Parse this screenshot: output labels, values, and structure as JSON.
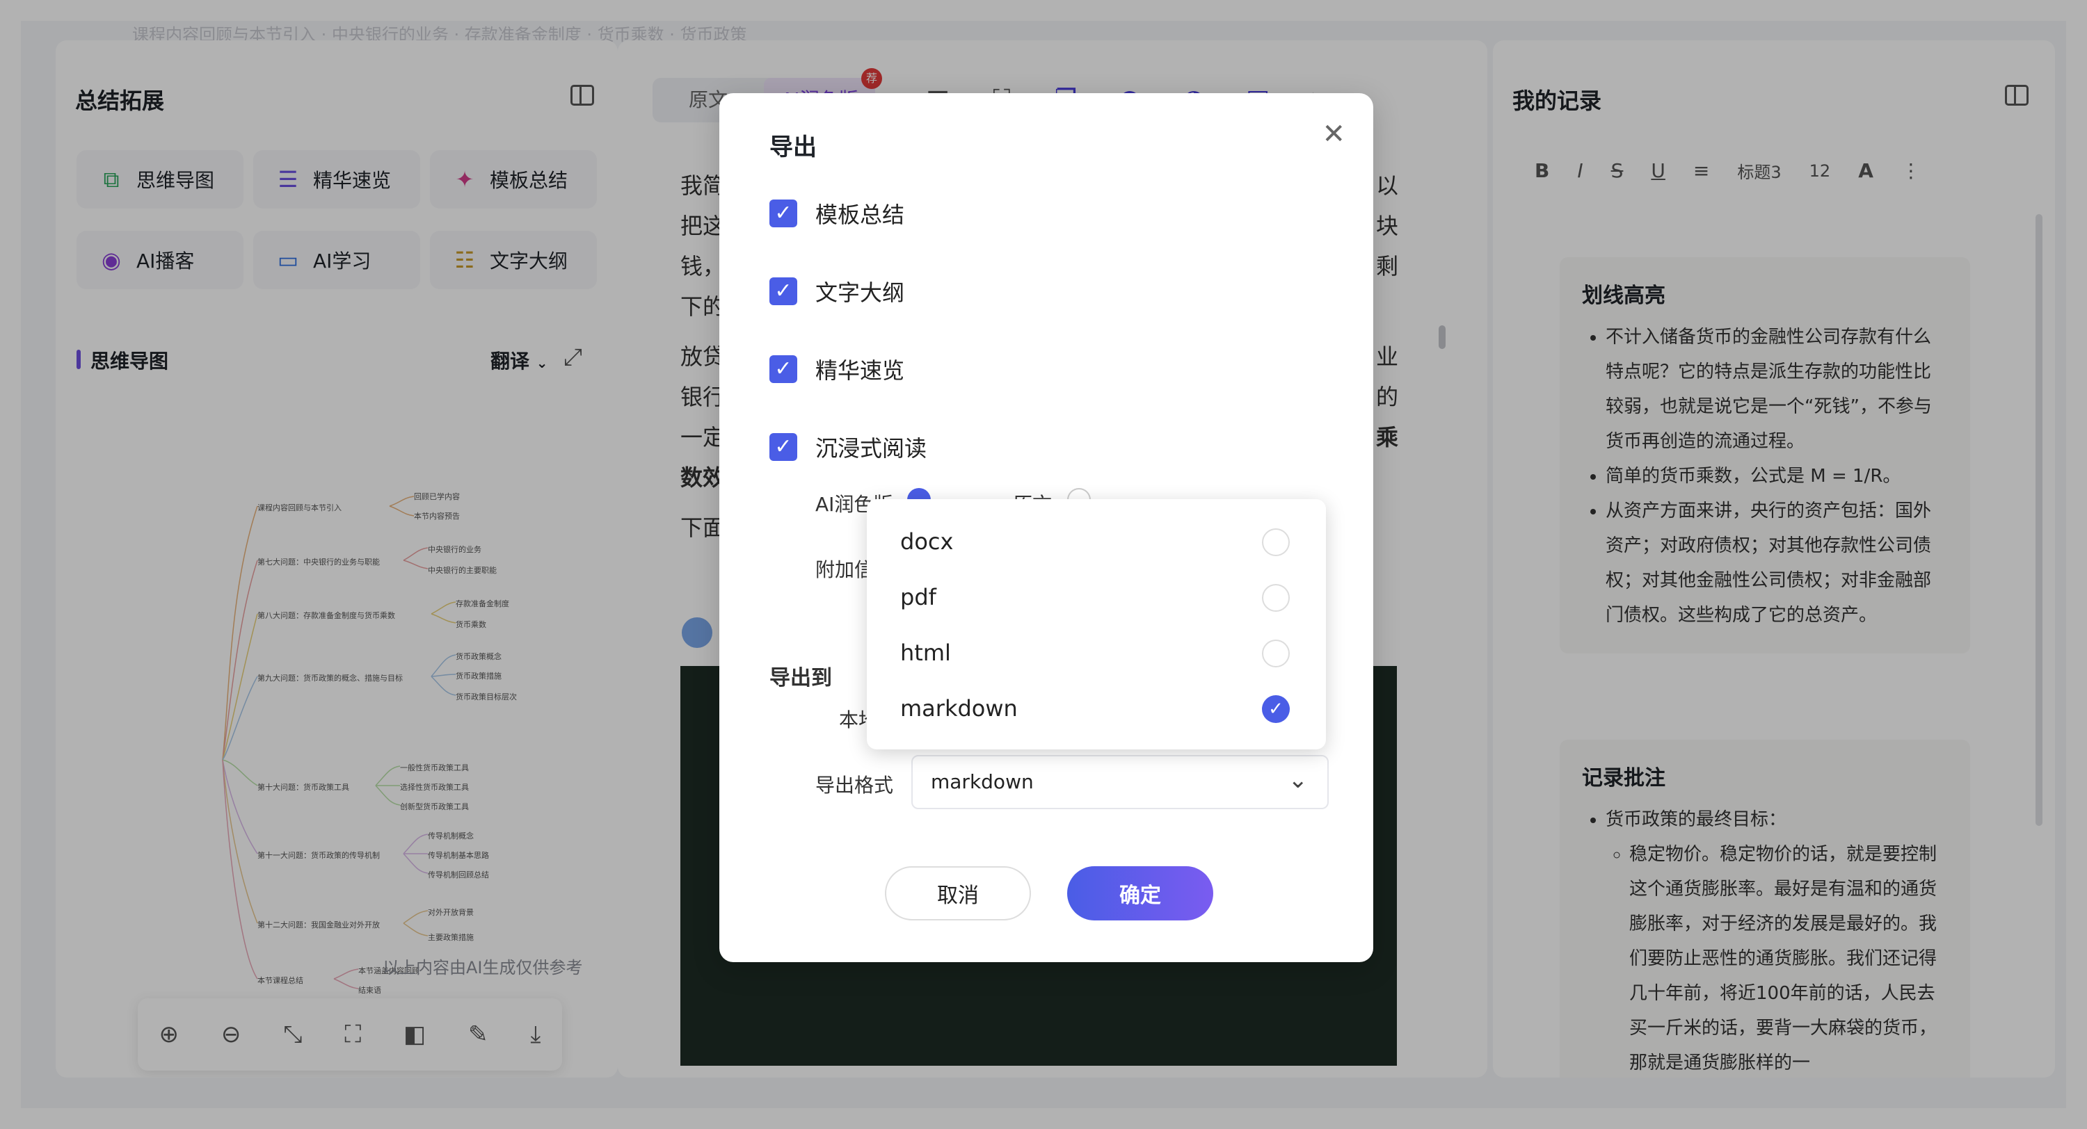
{
  "top_strip": "课程内容回顾与本节引入 · 中央银行的业务 · 存款准备金制度 · 货币乘数 · 货币政策",
  "left_panel": {
    "title": "总结拓展",
    "tools": [
      {
        "label": "思维导图",
        "icon": "mindmap-icon"
      },
      {
        "label": "精华速览",
        "icon": "list-icon"
      },
      {
        "label": "模板总结",
        "icon": "sparkle-icon"
      },
      {
        "label": "AI播客",
        "icon": "podcast-icon"
      },
      {
        "label": "AI学习",
        "icon": "chat-icon"
      },
      {
        "label": "文字大纲",
        "icon": "outline-icon"
      }
    ],
    "section_title": "思维导图",
    "translate_label": "翻译",
    "mindmap_nodes": [
      "课程内容回顾与本节引入",
      "回顾已学内容",
      "本节内容预告",
      "第七大问题：中央银行的业务与职能",
      "中央银行的业务",
      "中央银行的主要职能",
      "第八大问题：存款准备金制度与货币乘数",
      "存款准备金制度",
      "货币乘数",
      "第九大问题：货币政策的概念、措施与目标",
      "货币政策概念",
      "货币政策措施",
      "货币政策目标层次",
      "第十大问题：货币政策工具",
      "一般性货币政策工具",
      "选择性货币政策工具",
      "创新型货币政策工具",
      "第十一大问题：货币政策的传导机制",
      "传导机制概念",
      "传导机制基本思路",
      "传导机制回顾总结",
      "第十二大问题：我国金融业对外开放",
      "对外开放背景",
      "主要政策措施",
      "本节课程总结",
      "本节涵盖内容回顾",
      "结束语"
    ],
    "ai_notice": "以上内容由AI生成仅供参考"
  },
  "middle_panel": {
    "tabs": [
      "原文",
      "AI润色版"
    ],
    "badge": "荐",
    "doc_lines": [
      "我简",
      "把这",
      "钱，",
      "下的",
      "放贷",
      "银行",
      "一定",
      "数效",
      "下面"
    ],
    "doc_right_chars": [
      "以",
      "块",
      "剩",
      "业",
      "的",
      "乘"
    ]
  },
  "right_panel": {
    "title": "我的记录",
    "format": {
      "heading": "标题3",
      "size": "12"
    },
    "note1": {
      "title": "划线高亮",
      "items": [
        "不计入储备货币的金融性公司存款有什么特点呢？它的特点是派生存款的功能性比较弱，也就是说它是一个“死钱”，不参与货币再创造的流通过程。",
        "简单的货币乘数，公式是 M = 1/R。",
        "从资产方面来讲，央行的资产包括：国外资产；对政府债权；对其他存款性公司债权；对其他金融性公司债权；对非金融部门债权。这些构成了它的总资产。"
      ]
    },
    "note2": {
      "title": "记录批注",
      "item": "货币政策的最终目标：",
      "sub": "稳定物价。稳定物价的话，就是要控制这个通货膨胀率。最好是有温和的通货膨胀率，对于经济的发展是最好的。我们要防止恶性的通货膨胀。我们还记得几十年前，将近100年前的话，人民去买一斤米的话，要背一大麻袋的货币，那就是通货膨胀样的一"
    }
  },
  "modal": {
    "title": "导出",
    "options": [
      "模板总结",
      "文字大纲",
      "精华速览",
      "沉浸式阅读"
    ],
    "sub_ai": "AI润色版",
    "sub_original": "原文",
    "attach_label": "附加信息",
    "export_to_label": "导出到",
    "export_to_value": "本地",
    "format_label": "导出格式",
    "format_value": "markdown",
    "cancel": "取消",
    "confirm": "确定"
  },
  "dropdown": {
    "options": [
      "docx",
      "pdf",
      "html",
      "markdown"
    ],
    "selected": "markdown"
  }
}
